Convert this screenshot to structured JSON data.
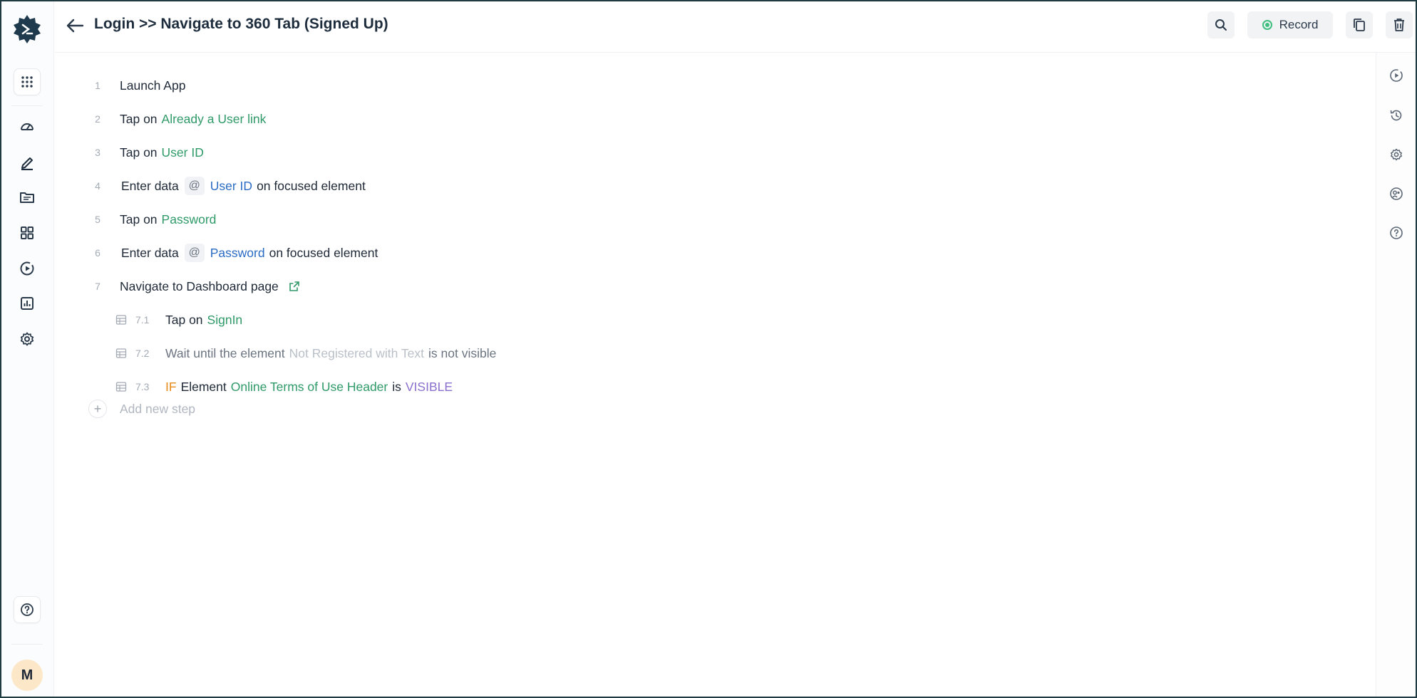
{
  "header": {
    "title": "Login >> Navigate to 360 Tab (Signed Up)",
    "record_label": "Record"
  },
  "user": {
    "avatar_initial": "M"
  },
  "steps": [
    {
      "num": "1",
      "parts": [
        {
          "text": "Launch App",
          "kind": "plain"
        }
      ]
    },
    {
      "num": "2",
      "parts": [
        {
          "text": "Tap on",
          "kind": "plain"
        },
        {
          "text": "Already a User link",
          "kind": "green"
        }
      ]
    },
    {
      "num": "3",
      "parts": [
        {
          "text": "Tap on",
          "kind": "plain"
        },
        {
          "text": "User ID",
          "kind": "green"
        }
      ]
    },
    {
      "num": "4",
      "parts": [
        {
          "text": "Enter data",
          "kind": "plain"
        },
        {
          "text": "@",
          "kind": "at"
        },
        {
          "text": "User ID",
          "kind": "blue"
        },
        {
          "text": "on focused element",
          "kind": "plain"
        }
      ]
    },
    {
      "num": "5",
      "parts": [
        {
          "text": "Tap on",
          "kind": "plain"
        },
        {
          "text": "Password",
          "kind": "green"
        }
      ]
    },
    {
      "num": "6",
      "parts": [
        {
          "text": "Enter data",
          "kind": "plain"
        },
        {
          "text": "@",
          "kind": "at"
        },
        {
          "text": "Password",
          "kind": "blue"
        },
        {
          "text": "on focused element",
          "kind": "plain"
        }
      ]
    },
    {
      "num": "7",
      "parts": [
        {
          "text": "Navigate to Dashboard page",
          "kind": "plain"
        }
      ],
      "external_link": true
    }
  ],
  "substeps": [
    {
      "num": "7.1",
      "parts": [
        {
          "text": "Tap on",
          "kind": "plain"
        },
        {
          "text": "SignIn",
          "kind": "green"
        }
      ]
    },
    {
      "num": "7.2",
      "parts": [
        {
          "text": "Wait until the element",
          "kind": "grey"
        },
        {
          "text": "Not Registered with Text",
          "kind": "faded"
        },
        {
          "text": "is not visible",
          "kind": "grey"
        }
      ]
    },
    {
      "num": "7.3",
      "parts": [
        {
          "text": "IF",
          "kind": "orange"
        },
        {
          "text": "Element",
          "kind": "plain"
        },
        {
          "text": "Online Terms of Use Header",
          "kind": "green"
        },
        {
          "text": "is",
          "kind": "plain"
        },
        {
          "text": "VISIBLE",
          "kind": "purple"
        }
      ]
    }
  ],
  "add_step_label": "Add new step",
  "colors": {
    "accent_green": "#2f9a68",
    "link_blue": "#2a6cc4",
    "record_green": "#3fbf7f"
  }
}
